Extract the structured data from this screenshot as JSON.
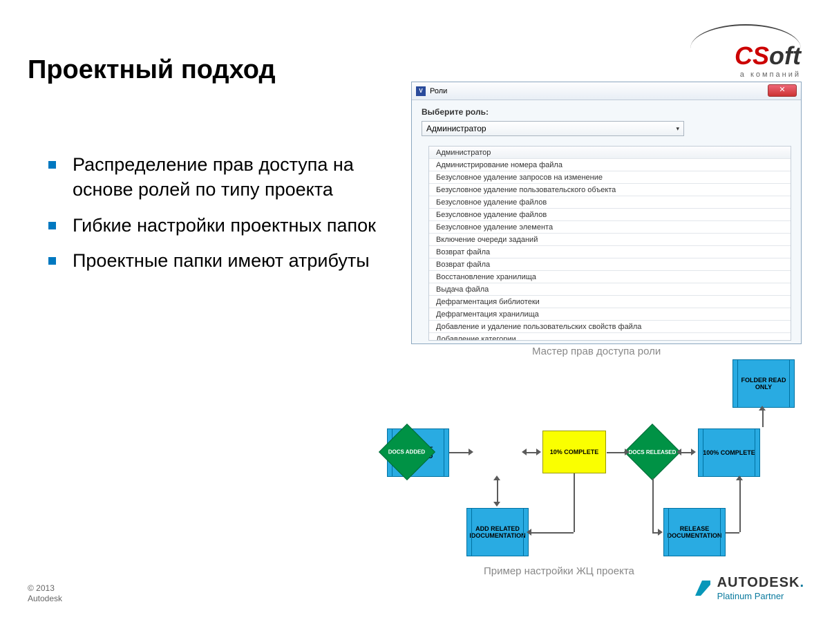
{
  "title": "Проектный подход",
  "logo": {
    "brand1": "CS",
    "brand2": "oft",
    "sub": "а компаний"
  },
  "bullets": [
    "Распределение прав доступа на основе ролей по типу проекта",
    "Гибкие настройки проектных папок",
    "Проектные папки имеют атрибуты"
  ],
  "dialog": {
    "title": "Роли",
    "label": "Выберите роль:",
    "selected": "Администратор",
    "rows": [
      "Администратор",
      "Администрирование номера файла",
      "Безусловное удаление запросов на изменение",
      "Безусловное удаление пользовательского объекта",
      "Безусловное удаление файлов",
      "Безусловное удаление файлов",
      "Безусловное удаление элемента",
      "Включение очереди заданий",
      "Возврат файла",
      "Возврат файла",
      "Восстановление хранилища",
      "Выдача файла",
      "Дефрагментация библиотеки",
      "Дефрагментация хранилища",
      "Добавление и удаление пользовательских свойств файла",
      "Добавление категории"
    ]
  },
  "caption1": "Мастер  прав  доступа  роли",
  "caption2": "Пример  настройки  ЖЦ проекта",
  "flow": {
    "projectCreated": "PROJECT CREATED",
    "docsAdded": "DOCS ADDED",
    "tenComplete": "10% COMPLETE",
    "docsReleased": "DOCS RELEASED",
    "hundredComplete": "100% COMPLETE",
    "addRelated": "ADD RELATED IDOCUMENTATION",
    "releaseDoc": "RELEASE DOCUMENTATION",
    "folderRead": "FOLDER READ ONLY"
  },
  "autodesk": {
    "name": "AUTODESK",
    "sub": "Platinum Partner",
    "dot": "."
  },
  "copyright": {
    "l1": "© 2013",
    "l2": "Autodesk"
  }
}
